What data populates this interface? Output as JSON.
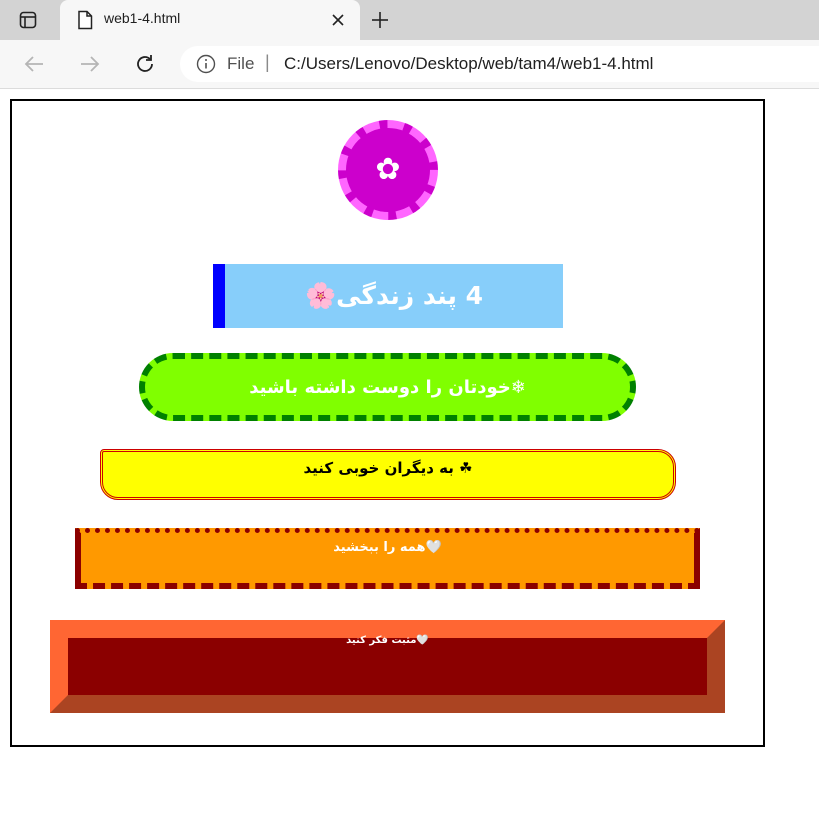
{
  "browser": {
    "tab_title": "web1-4.html",
    "address_scheme": "File",
    "address_separator": "|",
    "address_url": "C:/Users/Lenovo/Desktop/web/tam4/web1-4.html"
  },
  "page": {
    "badge_symbol": "✿",
    "title": "4 پند زندگی🌸",
    "tips": [
      "❄خودتان را دوست داشته باشید",
      "☘ به دیگران خوبی کنید",
      "🤍همه را ببخشید",
      "🤍مثبت فکر کنید"
    ]
  },
  "colors": {
    "badge_fill": "#cc00cc",
    "badge_border": "#ff66ff",
    "title_bg": "#87cefa",
    "title_accent": "#0000ff",
    "tip1_bg": "#80ff00",
    "tip1_border": "#008000",
    "tip2_bg": "#ffff00",
    "tip2_border": "#cc0000",
    "tip3_bg": "#ff9900",
    "tip3_border": "#8b0000",
    "tip4_bg": "#8b0000",
    "tip4_border": "#ff6633"
  }
}
